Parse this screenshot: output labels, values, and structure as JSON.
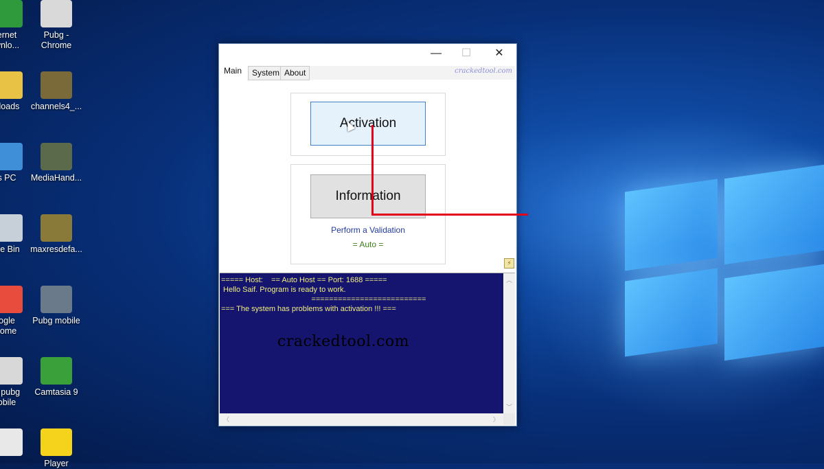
{
  "desktop": {
    "icons": [
      {
        "label": "ernet\nwnlo...",
        "icon": "ie-icon",
        "color": "#2f9a3c"
      },
      {
        "label": "Pubg -\nChrome",
        "icon": "chrome-shortcut-icon",
        "color": "#d9d9d9"
      },
      {
        "label": "nloads",
        "icon": "downloads-icon",
        "color": "#e7c245"
      },
      {
        "label": "channels4_...",
        "icon": "image-file-icon",
        "color": "#7a6a3a"
      },
      {
        "label": "s PC",
        "icon": "pc-icon",
        "color": "#3e8ed8"
      },
      {
        "label": "MediaHand...",
        "icon": "image-file-icon",
        "color": "#5b6a4b"
      },
      {
        "label": "cle Bin",
        "icon": "recycle-bin-icon",
        "color": "#c7d0d8"
      },
      {
        "label": "maxresdefa...",
        "icon": "image-file-icon",
        "color": "#8a7a3a"
      },
      {
        "label": "ogle\nrome",
        "icon": "chrome-icon",
        "color": "#e74c3c"
      },
      {
        "label": "Pubg mobile",
        "icon": "image-file-icon",
        "color": "#6a7a8a"
      },
      {
        "label": "u pubg\nobile",
        "icon": "panda-icon",
        "color": "#d8d8d8"
      },
      {
        "label": "Camtasia 9",
        "icon": "camtasia-icon",
        "color": "#3aa13a"
      },
      {
        "label": "",
        "icon": "document-icon",
        "color": "#e8e8e8"
      },
      {
        "label": "Player",
        "icon": "player-icon",
        "color": "#f5d21c"
      }
    ]
  },
  "window": {
    "controls": {
      "minimize": "—",
      "maximize": "☐",
      "close": "✕"
    },
    "tabs": [
      {
        "label": "Main",
        "active": true
      },
      {
        "label": "System",
        "active": false
      },
      {
        "label": "About",
        "active": false
      }
    ],
    "brand": "crackedtool.com",
    "activation_button": "Activation",
    "information_button": "Information",
    "validation_link": "Perform a Validation",
    "auto_label": "= Auto =",
    "log": [
      "===== Host:    == Auto Host == Port: 1688 =====",
      " Hello Saif. Program is ready to work.",
      "                                           ==========================",
      "=== The system has problems with activation !!! ==="
    ]
  },
  "watermark": "crackedtool.com",
  "colors": {
    "console_bg": "#15156f",
    "console_text": "#f2ef7e",
    "annotation": "#e4001b"
  }
}
